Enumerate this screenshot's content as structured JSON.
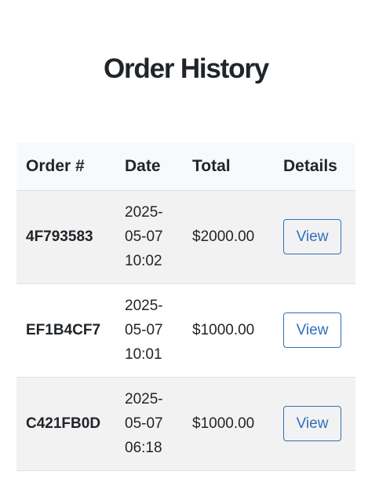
{
  "page": {
    "title": "Order History"
  },
  "table": {
    "headers": [
      "Order #",
      "Date",
      "Total",
      "Details"
    ],
    "rows": [
      {
        "order_id": "4F793583",
        "date_lines": [
          "2025-",
          "05-07",
          "10:02"
        ],
        "total": "$2000.00",
        "action_label": "View"
      },
      {
        "order_id": "EF1B4CF7",
        "date_lines": [
          "2025-",
          "05-07",
          "10:01"
        ],
        "total": "$1000.00",
        "action_label": "View"
      },
      {
        "order_id": "C421FB0D",
        "date_lines": [
          "2025-",
          "05-07",
          "06:18"
        ],
        "total": "$1000.00",
        "action_label": "View"
      }
    ]
  },
  "colors": {
    "accent": "#2f6fbd",
    "header_bg": "#f8f9fa",
    "stripe_bg": "#f2f2f2",
    "text": "#212529"
  }
}
